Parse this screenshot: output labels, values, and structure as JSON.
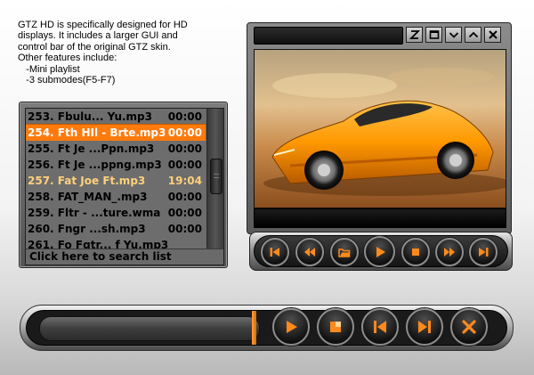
{
  "description": {
    "lines": [
      "GTZ HD is specifically designed for HD",
      "displays. It includes a larger GUI and",
      "control bar of the original GTZ skin.",
      "Other features include:",
      "   -Mini playlist",
      "   -3 submodes(F5-F7)"
    ]
  },
  "playlist": {
    "items": [
      {
        "name": "253. Fbulu... Yu.mp3",
        "time": "00:00",
        "state": "normal"
      },
      {
        "name": "254. Fth HIl - Brte.mp3",
        "time": "00:00",
        "state": "selected"
      },
      {
        "name": "255. Ft Je ...Ppn.mp3",
        "time": "00:00",
        "state": "normal"
      },
      {
        "name": "256. Ft Je ...ppng.mp3",
        "time": "00:00",
        "state": "normal"
      },
      {
        "name": "257. Fat Joe Ft.mp3",
        "time": "19:04",
        "state": "playing"
      },
      {
        "name": "258. FAT_MAN_.mp3",
        "time": "00:00",
        "state": "normal"
      },
      {
        "name": "259. Fltr - ...ture.wma",
        "time": "00:00",
        "state": "normal"
      },
      {
        "name": "260. Fngr ...sh.mp3",
        "time": "00:00",
        "state": "normal"
      },
      {
        "name": "261. Fo Fgtr... f Yu.mp3",
        "time": "",
        "state": "normal"
      }
    ],
    "search_label": "Click here to search list"
  },
  "window_buttons": [
    {
      "id": "z",
      "icon": "z-icon"
    },
    {
      "id": "restore",
      "icon": "restore-icon"
    },
    {
      "id": "down",
      "icon": "chevron-down-icon"
    },
    {
      "id": "up",
      "icon": "chevron-up-icon"
    },
    {
      "id": "close",
      "icon": "close-icon"
    }
  ],
  "mini_controls": [
    {
      "id": "prev",
      "icon": "skip-previous-icon"
    },
    {
      "id": "rewind",
      "icon": "rewind-icon"
    },
    {
      "id": "open",
      "icon": "folder-open-icon"
    },
    {
      "id": "play",
      "icon": "play-icon"
    },
    {
      "id": "stop",
      "icon": "stop-icon"
    },
    {
      "id": "forward",
      "icon": "fast-forward-icon"
    },
    {
      "id": "next",
      "icon": "skip-next-icon"
    }
  ],
  "main_controls": [
    {
      "id": "play",
      "icon": "play-icon"
    },
    {
      "id": "stop",
      "icon": "stop-icon"
    },
    {
      "id": "prev",
      "icon": "skip-previous-icon"
    },
    {
      "id": "next",
      "icon": "skip-next-icon"
    },
    {
      "id": "close",
      "icon": "close-icon"
    }
  ],
  "colors": {
    "accent": "#ff8a1c",
    "selected_row": "#ff7a0c",
    "playing_text": "#ffd07a"
  }
}
